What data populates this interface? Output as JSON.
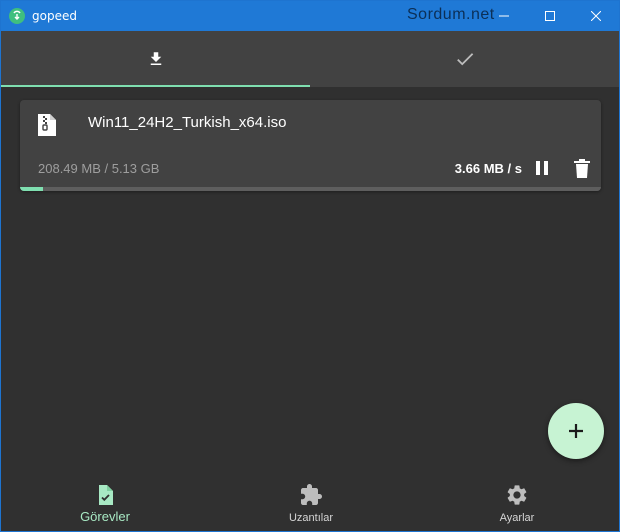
{
  "window": {
    "title": "gopeed",
    "watermark": "Sordum.net"
  },
  "tabs": [
    {
      "icon": "download-icon",
      "active": true
    },
    {
      "icon": "check-icon",
      "active": false
    }
  ],
  "tasks": [
    {
      "file_name": "Win11_24H2_Turkish_x64.iso",
      "size_text": "208.49 MB / 5.13 GB",
      "speed": "3.66 MB / s",
      "progress": 0.0397,
      "file_icon": "zip-file-icon"
    }
  ],
  "nav": {
    "tasks_label": "Görevler",
    "extensions_label": "Uzantılar",
    "settings_label": "Ayarlar"
  },
  "colors": {
    "accent": "#7fdfb0",
    "titlebar": "#1f79d6",
    "fab": "#c7f3d3",
    "background": "#303030",
    "surface": "#424242"
  }
}
